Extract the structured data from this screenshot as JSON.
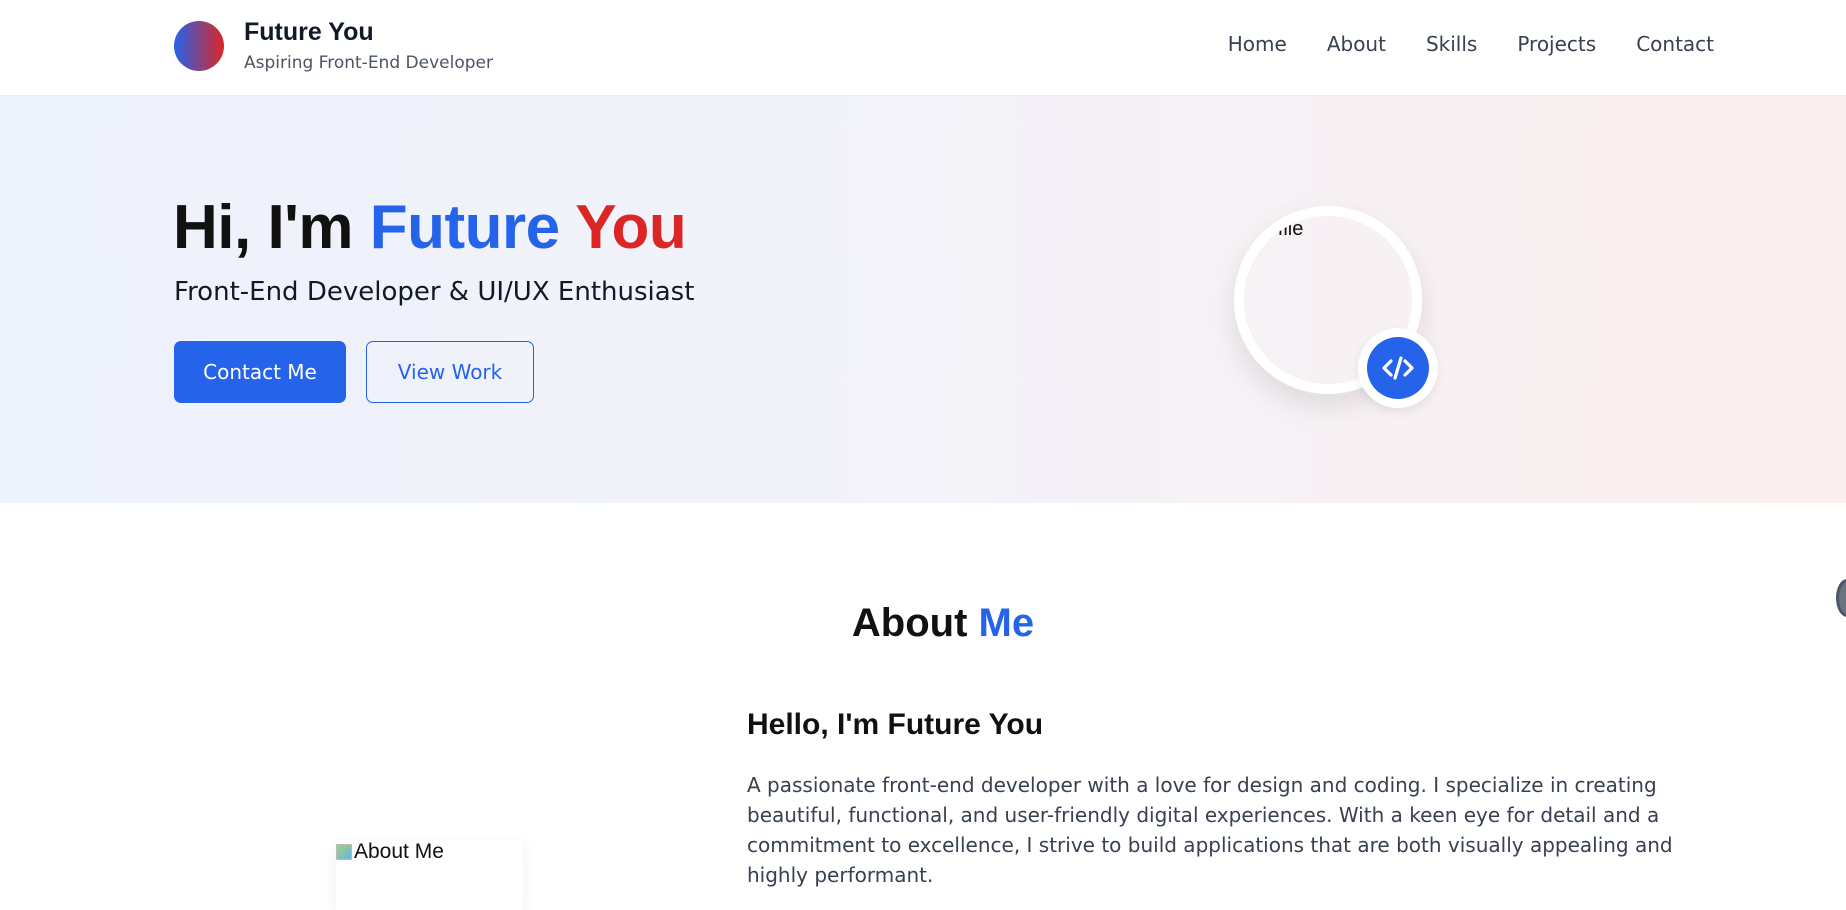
{
  "header": {
    "brand_title": "Future You",
    "brand_subtitle": "Aspiring Front-End Developer",
    "nav": [
      "Home",
      "About",
      "Skills",
      "Projects",
      "Contact"
    ]
  },
  "hero": {
    "title_prefix": "Hi, I'm ",
    "title_first": "Future",
    "title_second": "You",
    "subtitle": "Front-End Developer & UI/UX Enthusiast",
    "primary_button": "Contact Me",
    "secondary_button": "View Work",
    "profile_alt_text": "rofile",
    "badge_icon": "code-icon"
  },
  "about": {
    "heading_first": "About",
    "heading_second": "Me",
    "image_alt_text": "About Me",
    "name_heading": "Hello, I'm Future You",
    "paragraph": "A passionate front-end developer with a love for design and coding. I specialize in creating beautiful, functional, and user-friendly digital experiences. With a keen eye for detail and a commitment to excellence, I strive to build applications that are both visually appealing and highly performant."
  },
  "colors": {
    "accent_blue": "#2563eb",
    "accent_red": "#dc2626"
  }
}
